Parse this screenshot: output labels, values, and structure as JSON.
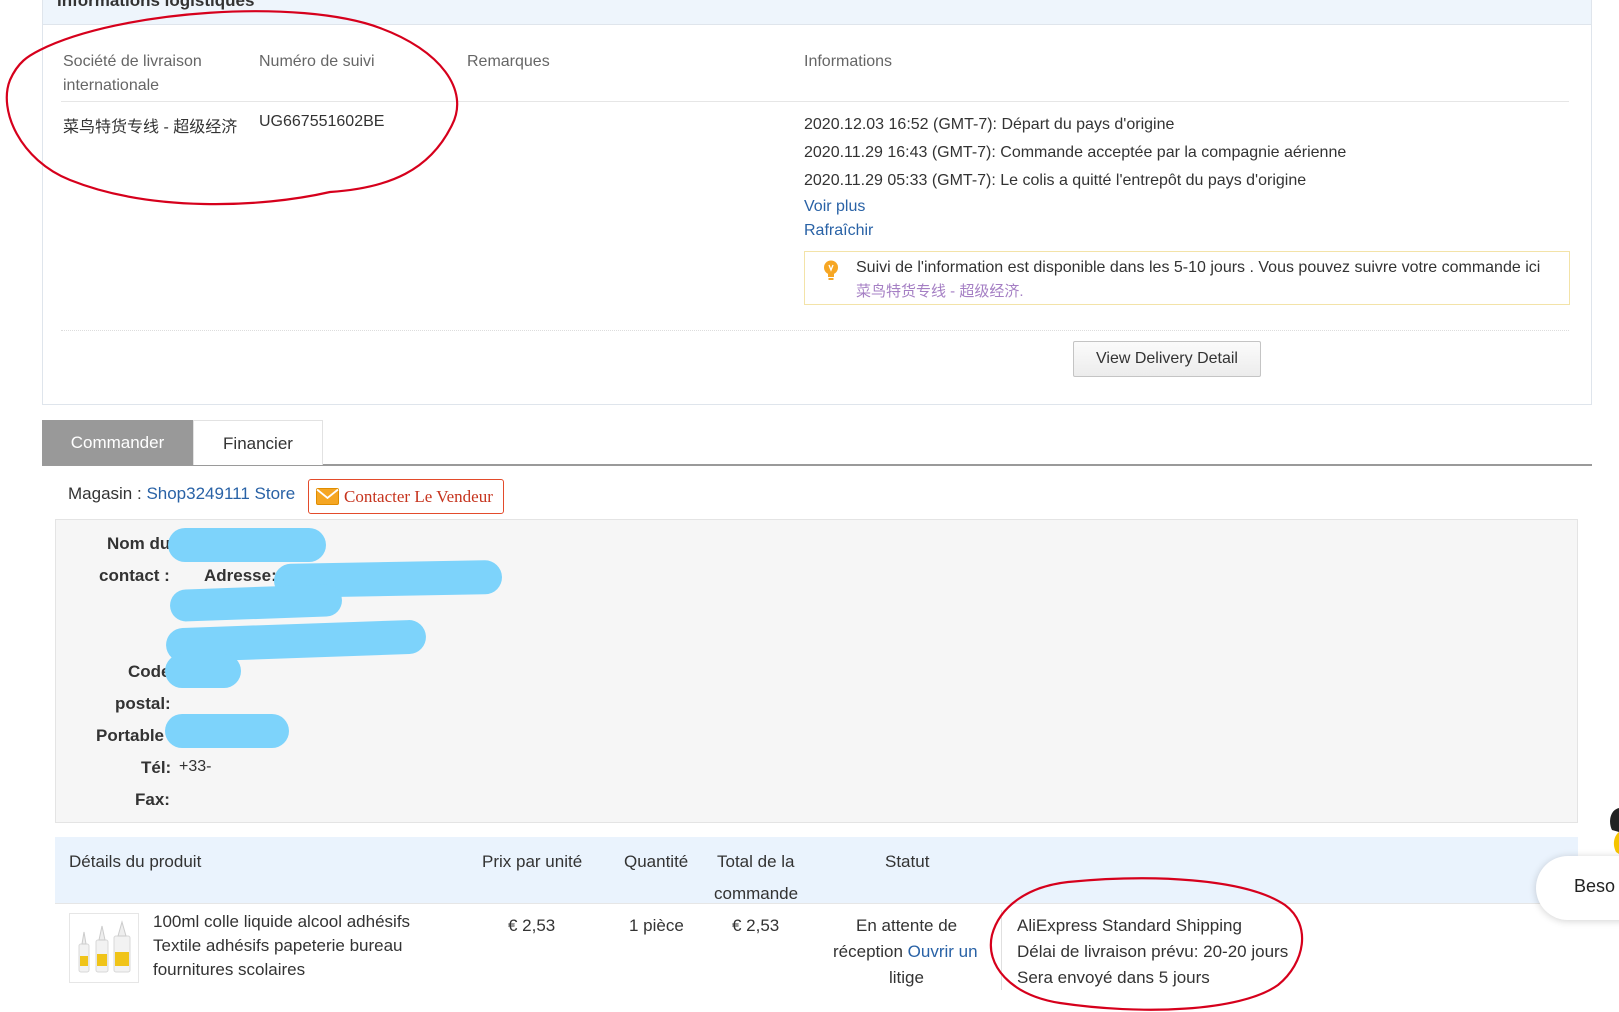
{
  "logistics": {
    "title": "Informations logistiques",
    "columns": {
      "carrier": "Société de livraison internationale",
      "tracking": "Numéro de suivi",
      "remarks": "Remarques",
      "info": "Informations"
    },
    "carrier_value": "菜鸟特货专线 - 超级经济",
    "tracking_value": "UG667551602BE",
    "events": [
      "2020.12.03 16:52 (GMT-7): Départ du pays d'origine",
      "2020.11.29 16:43 (GMT-7): Commande acceptée par la compagnie aérienne",
      "2020.11.29 05:33 (GMT-7): Le colis a quitté l'entrepôt du pays d'origine"
    ],
    "see_more": "Voir plus",
    "refresh": "Rafraîchir",
    "tip_text": "Suivi de l'information est disponible dans les 5-10 jours . Vous pouvez suivre votre commande ici",
    "tip_link": "菜鸟特货专线 - 超级经济.",
    "delivery_button": "View Delivery Detail"
  },
  "tabs": [
    "Commander",
    "Financier"
  ],
  "store": {
    "label": "Magasin : ",
    "name": "Shop3249111 Store",
    "contact_button": "Contacter Le Vendeur"
  },
  "address": {
    "contact_name_label_1": "Nom du",
    "contact_name_label_2": "contact :",
    "address_label": "Adresse:",
    "postal_label_1": "Code",
    "postal_label_2": "postal:",
    "mobile_label": "Portable",
    "phone_label": "Tél:",
    "phone_value": "+33-",
    "fax_label": "Fax:"
  },
  "products": {
    "headers": {
      "details": "Détails du produit",
      "unit_price": "Prix par unité",
      "quantity": "Quantité",
      "total_1": "Total de la",
      "total_2": "commande",
      "status": "Statut"
    },
    "rows": [
      {
        "name_lines": [
          "100ml colle liquide alcool adhésifs",
          "Textile adhésifs papeterie bureau",
          "fournitures scolaires"
        ],
        "unit_price": "€ 2,53",
        "quantity": "1 pièce",
        "total": "€ 2,53",
        "status_1": "En attente de",
        "status_2": "réception",
        "dispute_1": "Ouvrir un",
        "dispute_2": "litige",
        "shipping_method": "AliExpress Standard Shipping",
        "delivery_estimate": "Délai de livraison prévu: 20-20 jours",
        "ships_in": "Sera envoyé dans 5 jours"
      }
    ]
  },
  "chat": {
    "label": "Beso"
  },
  "colors": {
    "link": "#2962a6",
    "annotation": "#d6001c",
    "redaction": "#7dd3fb",
    "header_bg": "#eaf3fd",
    "tab_active_bg": "#999999"
  }
}
